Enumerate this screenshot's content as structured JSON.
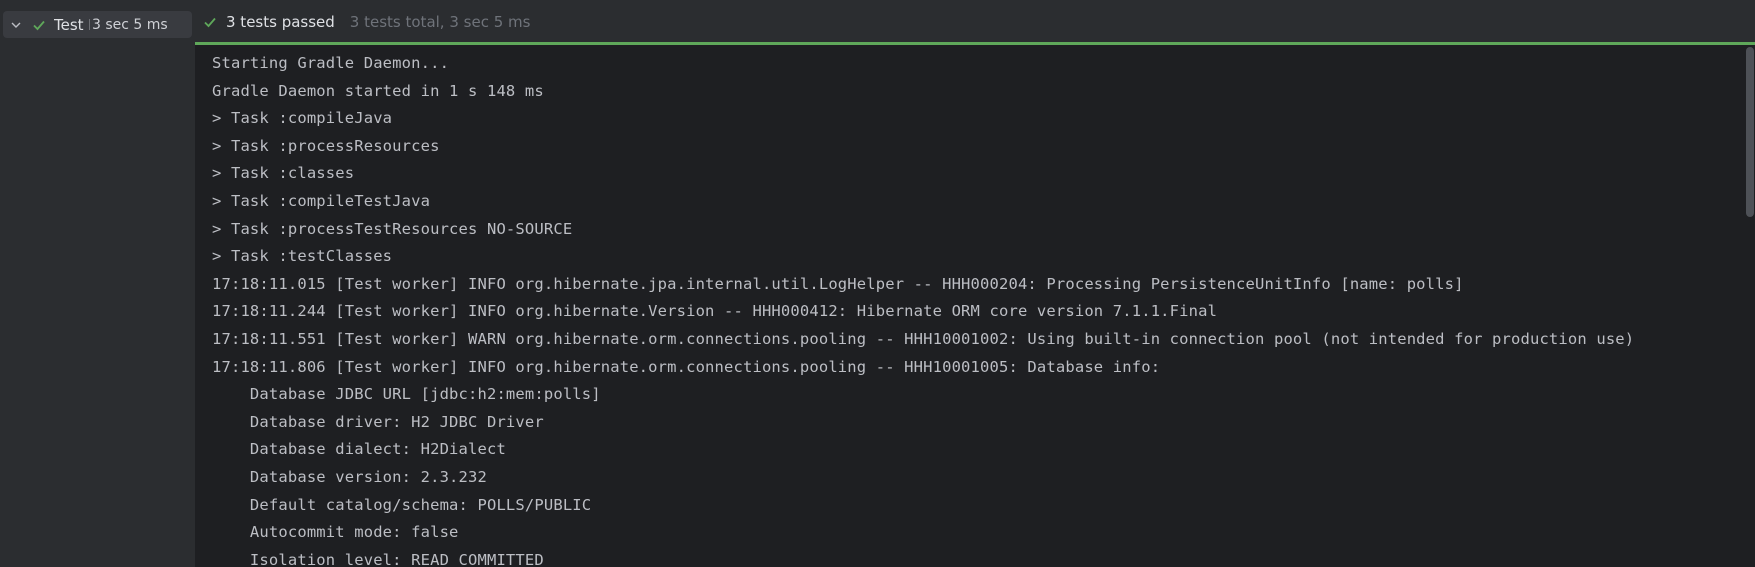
{
  "test_tree": {
    "root": {
      "name": "Test P",
      "duration": "3 sec 5 ms",
      "status_icon": "check-icon"
    }
  },
  "status_header": {
    "summary": "3 tests passed",
    "details": "3 tests total, 3 sec 5 ms",
    "progress_fraction": 1.0
  },
  "console": {
    "lines": [
      "Starting Gradle Daemon...",
      "Gradle Daemon started in 1 s 148 ms",
      "> Task :compileJava",
      "> Task :processResources",
      "> Task :classes",
      "> Task :compileTestJava",
      "> Task :processTestResources NO-SOURCE",
      "> Task :testClasses",
      "17:18:11.015 [Test worker] INFO org.hibernate.jpa.internal.util.LogHelper -- HHH000204: Processing PersistenceUnitInfo [name: polls]",
      "17:18:11.244 [Test worker] INFO org.hibernate.Version -- HHH000412: Hibernate ORM core version 7.1.1.Final",
      "17:18:11.551 [Test worker] WARN org.hibernate.orm.connections.pooling -- HHH10001002: Using built-in connection pool (not intended for production use)",
      "17:18:11.806 [Test worker] INFO org.hibernate.orm.connections.pooling -- HHH10001005: Database info:",
      "    Database JDBC URL [jdbc:h2:mem:polls]",
      "    Database driver: H2 JDBC Driver",
      "    Database dialect: H2Dialect",
      "    Database version: 2.3.232",
      "    Default catalog/schema: POLLS/PUBLIC",
      "    Autocommit mode: false",
      "    Isolation level: READ_COMMITTED"
    ]
  },
  "colors": {
    "success": "#5fa85a",
    "panel_bg": "#2b2d30",
    "console_bg": "#1e1f22"
  }
}
